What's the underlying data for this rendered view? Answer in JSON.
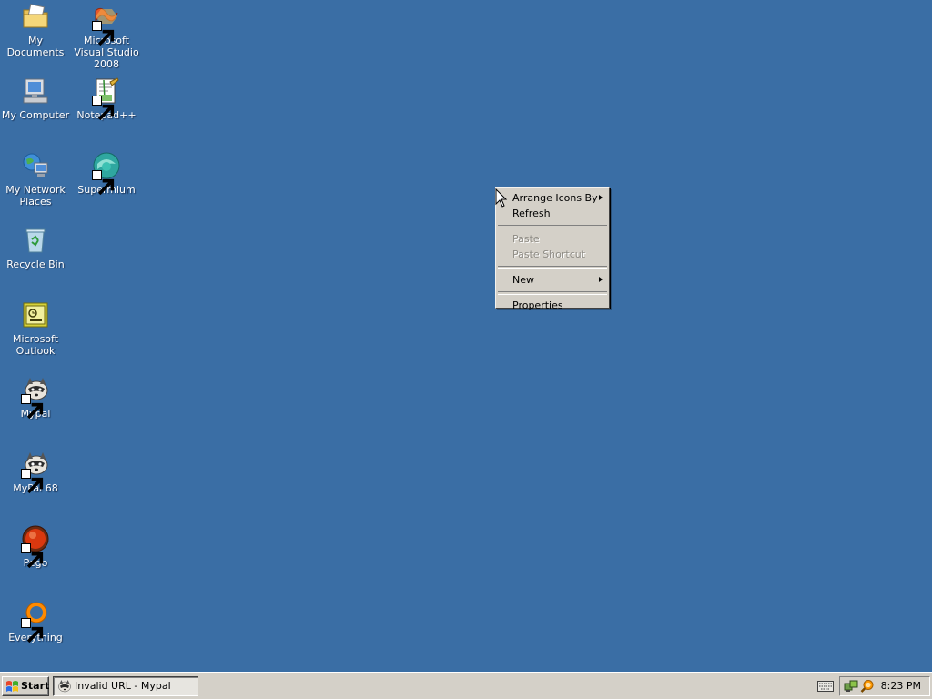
{
  "desktop": {
    "background_color": "#3a6ea5",
    "icons": [
      {
        "label": "My Documents",
        "icon": "folder-documents-icon"
      },
      {
        "label": "My Computer",
        "icon": "computer-icon"
      },
      {
        "label": "My Network Places",
        "icon": "network-places-icon"
      },
      {
        "label": "Recycle Bin",
        "icon": "recycle-bin-icon"
      },
      {
        "label": "Microsoft Outlook",
        "icon": "outlook-icon"
      },
      {
        "label": "Mypal",
        "icon": "mypal-raccoon-icon"
      },
      {
        "label": "MyPal 68",
        "icon": "mypal68-raccoon-icon"
      },
      {
        "label": "Pego",
        "icon": "pego-icon"
      },
      {
        "label": "Everything",
        "icon": "everything-search-icon"
      },
      {
        "label": "Microsoft Visual Studio 2008",
        "icon": "visual-studio-icon"
      },
      {
        "label": "Notepad++",
        "icon": "notepad-plus-plus-icon"
      },
      {
        "label": "Supermium",
        "icon": "supermium-icon"
      }
    ]
  },
  "context_menu": {
    "items": [
      {
        "label": "Arrange Icons By",
        "submenu": true,
        "enabled": true
      },
      {
        "label": "Refresh",
        "submenu": false,
        "enabled": true
      },
      {
        "label": "Paste",
        "submenu": false,
        "enabled": false
      },
      {
        "label": "Paste Shortcut",
        "submenu": false,
        "enabled": false
      },
      {
        "label": "New",
        "submenu": true,
        "enabled": true
      },
      {
        "label": "Properties",
        "submenu": false,
        "enabled": true
      }
    ]
  },
  "taskbar": {
    "start_label": "Start",
    "tasks": [
      {
        "label": "Invalid URL - Mypal",
        "icon": "mypal-raccoon-icon"
      }
    ],
    "tray": {
      "icons": [
        "keyboard-icon",
        "network-tray-icon",
        "search-tray-icon"
      ],
      "clock": "8:23 PM"
    }
  }
}
